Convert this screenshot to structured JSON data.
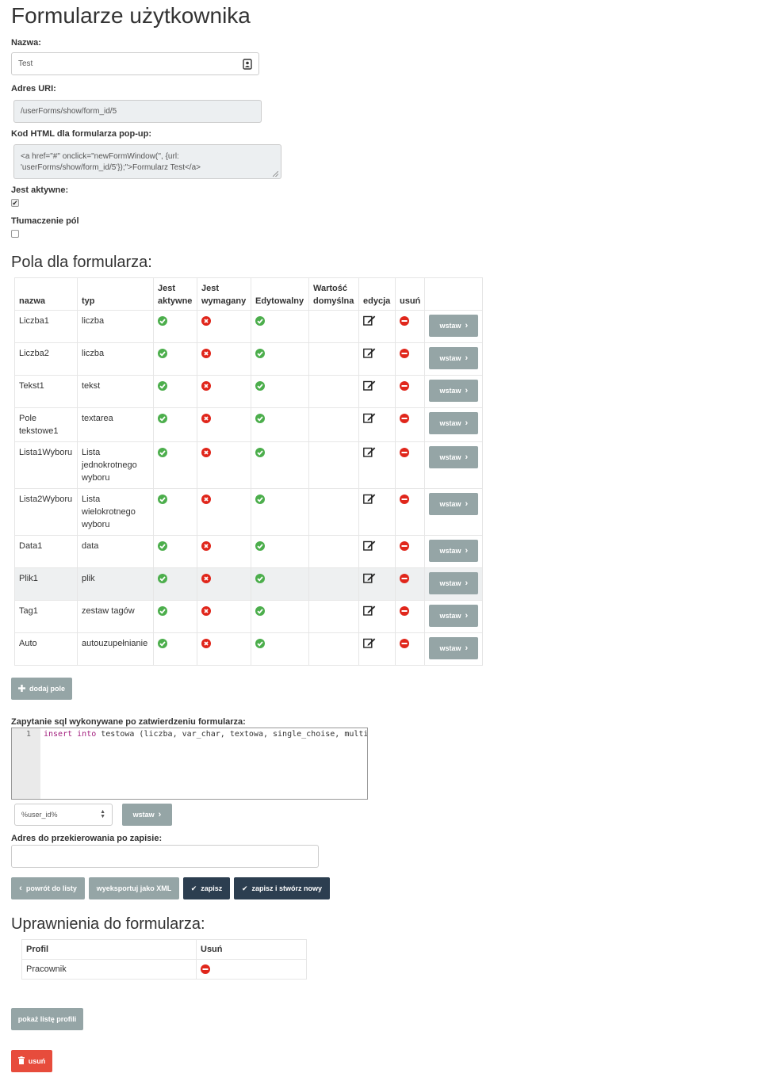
{
  "title": "Formularze użytkownika",
  "form": {
    "name_label": "Nazwa:",
    "name_value": "Test",
    "uri_label": "Adres URI:",
    "uri_value": "/userForms/show/form_id/5",
    "popup_label": "Kod HTML dla formularza pop-up:",
    "popup_value": "<a href=\"#\" onclick=\"newFormWindow('', {url: 'userForms/show/form_id/5'});\">Formularz Test</a>",
    "active_label": "Jest aktywne:",
    "active_checked": true,
    "translate_label": "Tłumaczenie pól",
    "translate_checked": false
  },
  "fields_section": {
    "title": "Pola dla formularza:",
    "headers": {
      "name": "nazwa",
      "type": "typ",
      "active": "Jest aktywne",
      "required": "Jest wymagany",
      "editable": "Edytowalny",
      "default": "Wartość domyślna",
      "edit": "edycja",
      "delete": "usuń"
    },
    "insert_label": "wstaw",
    "rows": [
      {
        "name": "Liczba1",
        "type": "liczba"
      },
      {
        "name": "Liczba2",
        "type": "liczba"
      },
      {
        "name": "Tekst1",
        "type": "tekst"
      },
      {
        "name": "Pole tekstowe1",
        "type": "textarea"
      },
      {
        "name": "Lista1Wyboru",
        "type": "Lista jednokrotnego wyboru"
      },
      {
        "name": "Lista2Wyboru",
        "type": "Lista wielokrotnego wyboru"
      },
      {
        "name": "Data1",
        "type": "data"
      },
      {
        "name": "Plik1",
        "type": "plik"
      },
      {
        "name": "Tag1",
        "type": "zestaw tagów"
      },
      {
        "name": "Auto",
        "type": "autouzupełnianie"
      }
    ],
    "add_field_label": "dodaj pole"
  },
  "sql": {
    "label": "Zapytanie sql wykonywane po zatwierdzeniu formularza:",
    "line_number": "1",
    "code_kw1": "insert",
    "code_kw2": "into",
    "code_rest": " testowa (liczba, var_char, textowa, single_choise, multip",
    "select_value": "%user_id%",
    "insert_label": "wstaw"
  },
  "redirect": {
    "label": "Adres do przekierowania po zapisie:",
    "value": ""
  },
  "actions": {
    "back": "powrót do listy",
    "export": "wyeksportuj jako XML",
    "save": "zapisz",
    "save_new": "zapisz i stwórz nowy"
  },
  "permissions": {
    "title": "Uprawnienia do formularza:",
    "col_profile": "Profil",
    "col_delete": "Usuń",
    "rows": [
      {
        "profile": "Pracownik"
      }
    ],
    "show_profiles": "pokaż listę profili"
  },
  "delete_label": "usuń",
  "colors": {
    "gray_button": "#95a5a6",
    "dark_button": "#2c3e50",
    "danger": "#e74c3c",
    "success": "#4cae4c"
  }
}
